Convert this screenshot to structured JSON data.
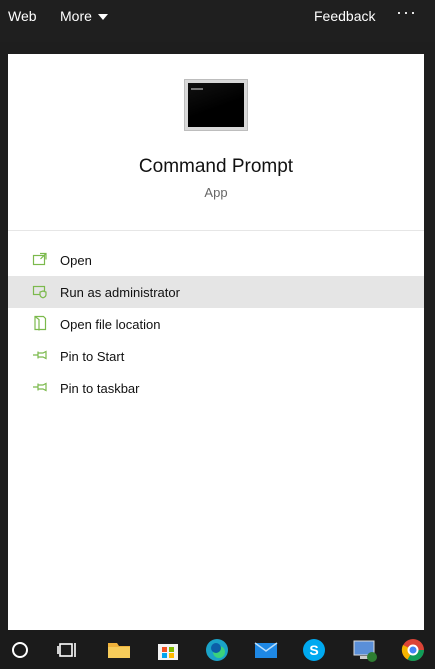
{
  "topbar": {
    "tab_web": "Web",
    "tab_more": "More",
    "feedback": "Feedback",
    "more_options": "···"
  },
  "app": {
    "title": "Command Prompt",
    "type": "App",
    "icon": "command-prompt-icon"
  },
  "actions": [
    {
      "label": "Open",
      "icon": "open-window-icon"
    },
    {
      "label": "Run as administrator",
      "icon": "shield-icon"
    },
    {
      "label": "Open file location",
      "icon": "file-location-icon"
    },
    {
      "label": "Pin to Start",
      "icon": "pin-icon"
    },
    {
      "label": "Pin to taskbar",
      "icon": "pin-icon"
    }
  ],
  "taskbar": [
    "search-icon",
    "task-view-icon",
    "file-explorer-icon",
    "store-icon",
    "edge-icon",
    "mail-icon",
    "skype-icon",
    "remote-desktop-icon",
    "chrome-icon"
  ],
  "colors": {
    "accent_green": "#7bb94c",
    "highlight": "#e5e5e5",
    "topbar_bg": "#1f1f1f"
  }
}
